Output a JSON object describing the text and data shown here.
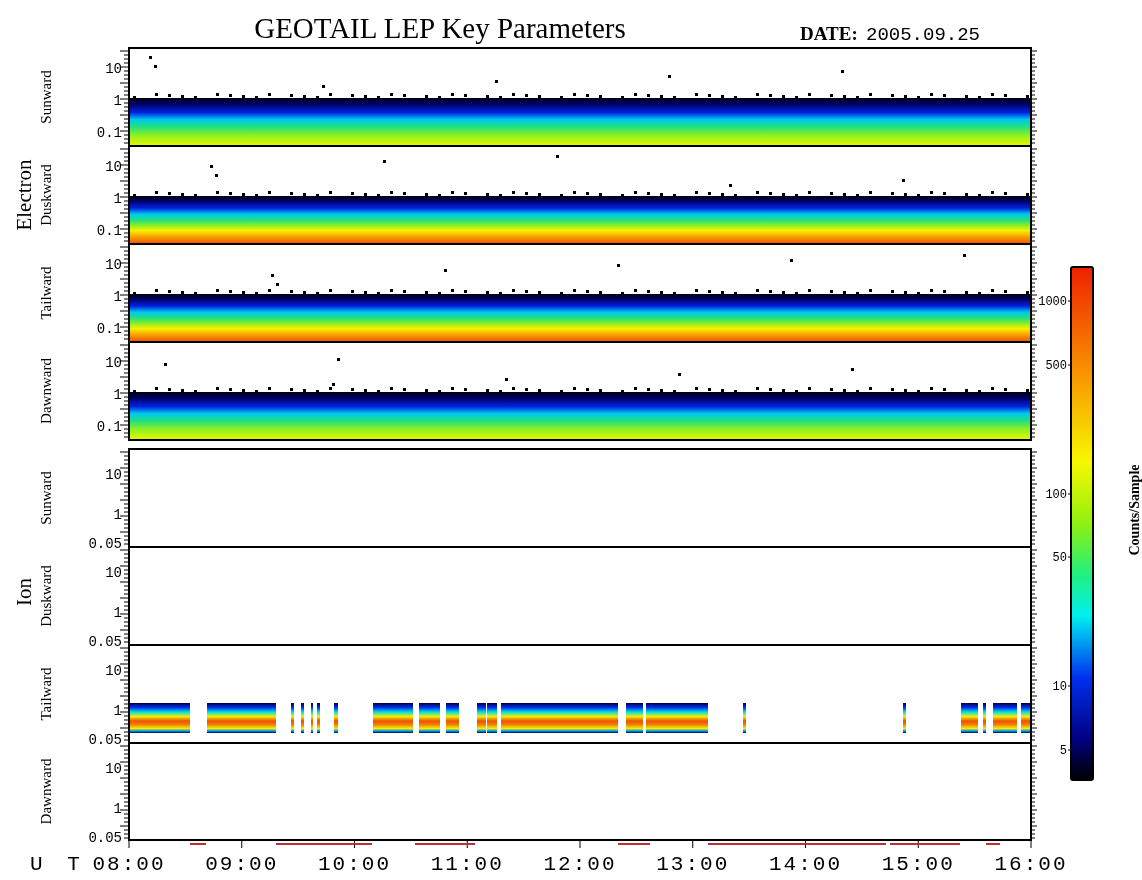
{
  "title": "GEOTAIL LEP Key Parameters",
  "date": {
    "label": "DATE:",
    "value": "2005.09.25"
  },
  "groups": [
    {
      "label": "Electron",
      "panels": [
        {
          "label": "Sunward",
          "kind": "band",
          "yticks": [
            "10",
            "1",
            "0.1"
          ]
        },
        {
          "label": "Duskward",
          "kind": "hot-band",
          "yticks": [
            "10",
            "1",
            "0.1"
          ]
        },
        {
          "label": "Tailward",
          "kind": "hot-band",
          "yticks": [
            "10",
            "1",
            "0.1"
          ]
        },
        {
          "label": "Dawnward",
          "kind": "band",
          "yticks": [
            "10",
            "1",
            "0.1"
          ]
        }
      ]
    },
    {
      "label": "Ion",
      "panels": [
        {
          "label": "Sunward",
          "kind": "empty",
          "yticks": [
            "10",
            "1",
            "0.05"
          ]
        },
        {
          "label": "Duskward",
          "kind": "empty",
          "yticks": [
            "10",
            "1",
            "0.05"
          ]
        },
        {
          "label": "Tailward",
          "kind": "bursts",
          "yticks": [
            "10",
            "1",
            "0.05"
          ]
        },
        {
          "label": "Dawnward",
          "kind": "empty",
          "yticks": [
            "10",
            "1",
            "0.05"
          ]
        }
      ]
    }
  ],
  "x_axis": {
    "label": "U T",
    "ticks": [
      "08:00",
      "09:00",
      "10:00",
      "11:00",
      "12:00",
      "13:00",
      "14:00",
      "15:00",
      "16:00"
    ]
  },
  "colorbar": {
    "label": "Counts/Sample",
    "ticks": [
      "1000",
      "500",
      "100",
      "50",
      "10",
      "5"
    ]
  }
}
